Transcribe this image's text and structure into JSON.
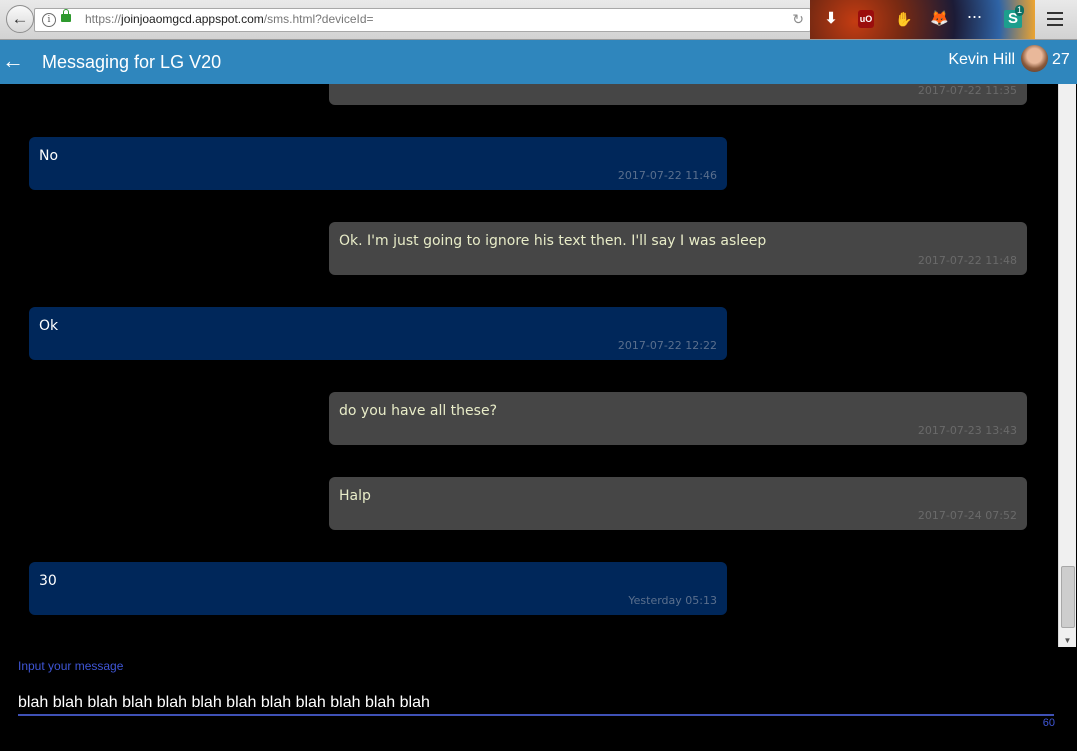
{
  "browser": {
    "url_scheme": "https://",
    "url_host": "joinjoaomgcd.appspot.com",
    "url_path": "/sms.html?deviceId=",
    "back_glyph": "←",
    "info_glyph": "i",
    "reload_glyph": "↻",
    "extensions": {
      "download": "⬇",
      "ublock": "uO",
      "hand": "✋",
      "fox": "🦊",
      "dots": "···",
      "s_label": "S",
      "s_badge": "1"
    }
  },
  "header": {
    "back_glyph": "←",
    "title": "Messaging for LG V20",
    "user_name": "Kevin Hill",
    "count": "27",
    "color": "#2f86bd"
  },
  "messages": [
    {
      "direction": "out",
      "text": "",
      "time": "2017-07-22 11:35"
    },
    {
      "direction": "in",
      "text": "No",
      "time": "2017-07-22 11:46"
    },
    {
      "direction": "out",
      "text": "Ok. I'm just going to ignore his text then. I'll say I was asleep",
      "time": "2017-07-22 11:48"
    },
    {
      "direction": "in",
      "text": "Ok",
      "time": "2017-07-22 12:22"
    },
    {
      "direction": "out",
      "text": "do you have all these?",
      "time": "2017-07-23 13:43"
    },
    {
      "direction": "out",
      "text": "Halp",
      "time": "2017-07-24 07:52"
    },
    {
      "direction": "in",
      "text": "30",
      "time": "Yesterday 05:13"
    }
  ],
  "colors": {
    "incoming_bubble": "#00275a",
    "outgoing_bubble": "#464646",
    "accent": "#3f51b5"
  },
  "composer": {
    "label": "Input your message",
    "value": "blah blah blah blah blah blah blah blah blah blah blah blah",
    "remaining": "60"
  },
  "scrollbar": {
    "down_glyph": "▼"
  }
}
